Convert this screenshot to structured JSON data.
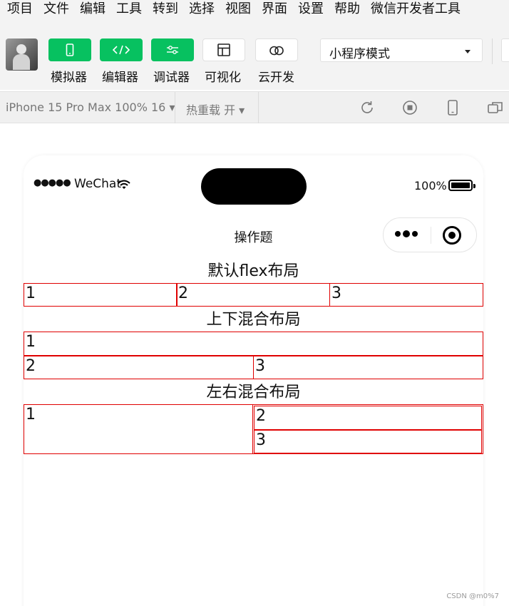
{
  "menubar": {
    "items": [
      "项目",
      "文件",
      "编辑",
      "工具",
      "转到",
      "选择",
      "视图",
      "界面",
      "设置",
      "帮助",
      "微信开发者工具"
    ]
  },
  "toolbar": {
    "buttons": [
      {
        "label": "模拟器",
        "icon": "phone-icon"
      },
      {
        "label": "编辑器",
        "icon": "code-icon"
      },
      {
        "label": "调试器",
        "icon": "sliders-icon"
      },
      {
        "label": "可视化",
        "icon": "layout-icon"
      },
      {
        "label": "云开发",
        "icon": "cloud-icon"
      }
    ],
    "mode_select": "小程序模式",
    "accent_color": "#07c160"
  },
  "devicebar": {
    "device": "iPhone 15 Pro Max 100% 16 ▾",
    "hot_reload": "热重载 开 ▾",
    "icons": [
      "refresh-icon",
      "stop-icon",
      "device-icon",
      "window-icon"
    ]
  },
  "phone": {
    "signal": "●●●●●",
    "carrier": "WeChat",
    "battery_pct": "100%",
    "nav_title": "操作题"
  },
  "page": {
    "sections": [
      {
        "title": "默认flex布局",
        "boxes": [
          "1",
          "2",
          "3"
        ]
      },
      {
        "title": "上下混合布局",
        "boxes": [
          "1",
          "2",
          "3"
        ]
      },
      {
        "title": "左右混合布局",
        "boxes": [
          "1",
          "2",
          "3"
        ]
      }
    ],
    "border_color": "#e00000"
  },
  "watermark": "CSDN @m0%7"
}
